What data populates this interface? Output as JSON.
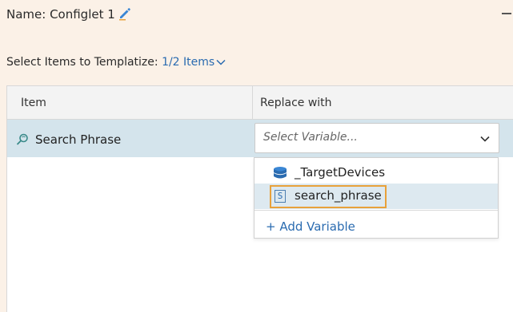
{
  "header": {
    "title": "Name: Configlet 1",
    "edit_icon": "pencil-icon",
    "collapse_icon": "minus-icon"
  },
  "select_items": {
    "label": "Select Items to Templatize:",
    "count": "1/2 Items"
  },
  "table": {
    "columns": [
      "Item",
      "Replace with"
    ],
    "rows": [
      {
        "icon": "search-phrase-icon",
        "item": "Search Phrase",
        "replace_placeholder": "Select Variable..."
      }
    ]
  },
  "dropdown": {
    "options": [
      {
        "icon": "database-icon",
        "label": "_TargetDevices"
      },
      {
        "icon": "string-variable-icon",
        "icon_text": "S",
        "label": "search_phrase"
      }
    ],
    "add_label": "+ Add Variable"
  },
  "colors": {
    "accent": "#2a6bb0",
    "highlight": "#e8a13a",
    "row_selected": "#d4e4ec",
    "background": "#fbf1e7"
  }
}
